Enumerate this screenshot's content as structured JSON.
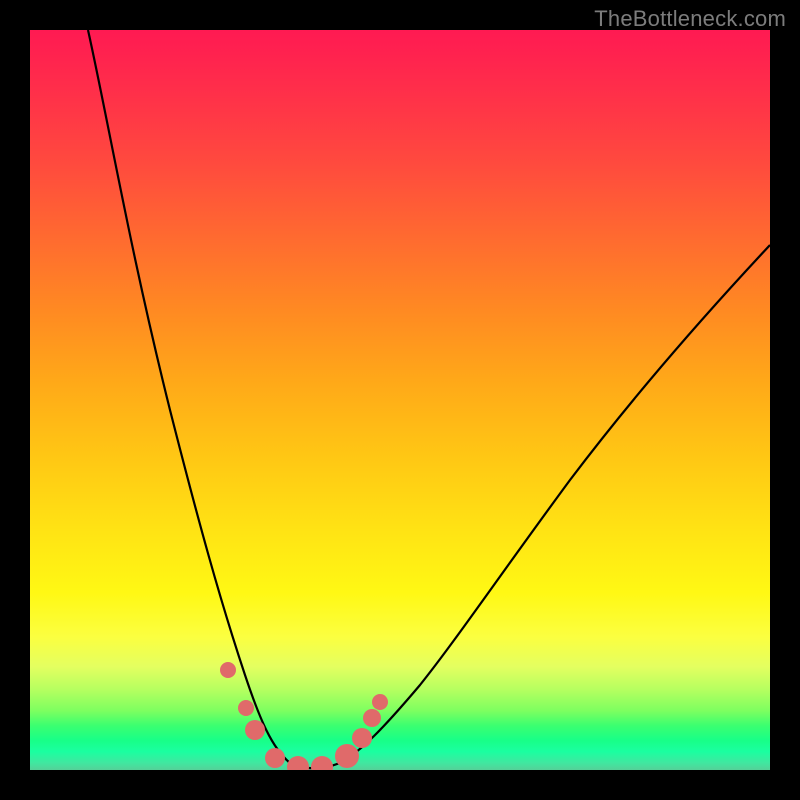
{
  "watermark": "TheBottleneck.com",
  "chart_data": {
    "type": "line",
    "title": "",
    "xlabel": "",
    "ylabel": "",
    "x_range_plot_units": [
      0,
      740
    ],
    "y_range_plot_units": [
      0,
      740
    ],
    "grid": false,
    "note": "Axes have no visible tick labels / units in the image; coordinates below are in plot-area pixel space (origin top-left of the 740x740 colored square). Curve is a smooth V-notch (bottleneck curve) touching the bottom around x≈250–310.",
    "series": [
      {
        "name": "bottleneck-curve",
        "x": [
          58,
          80,
          110,
          140,
          170,
          195,
          215,
          232,
          248,
          260,
          275,
          295,
          310,
          330,
          355,
          390,
          430,
          480,
          540,
          610,
          690,
          740
        ],
        "y": [
          0,
          110,
          250,
          380,
          490,
          580,
          645,
          690,
          720,
          733,
          738,
          738,
          733,
          720,
          698,
          655,
          600,
          530,
          450,
          360,
          270,
          215
        ]
      }
    ],
    "markers": {
      "name": "highlight-dots",
      "color_hex": "#e06a6a",
      "points": [
        {
          "x": 198,
          "y": 640,
          "r": 8
        },
        {
          "x": 216,
          "y": 678,
          "r": 8
        },
        {
          "x": 225,
          "y": 700,
          "r": 10
        },
        {
          "x": 245,
          "y": 728,
          "r": 10
        },
        {
          "x": 268,
          "y": 737,
          "r": 11
        },
        {
          "x": 292,
          "y": 737,
          "r": 11
        },
        {
          "x": 317,
          "y": 726,
          "r": 12
        },
        {
          "x": 332,
          "y": 708,
          "r": 10
        },
        {
          "x": 342,
          "y": 688,
          "r": 9
        },
        {
          "x": 350,
          "y": 672,
          "r": 8
        }
      ]
    },
    "background_gradient": {
      "direction": "top-to-bottom",
      "stops": [
        {
          "pos": 0.0,
          "hex": "#ff1a52"
        },
        {
          "pos": 0.38,
          "hex": "#ff8a22"
        },
        {
          "pos": 0.68,
          "hex": "#ffe414"
        },
        {
          "pos": 0.92,
          "hex": "#7dff60"
        },
        {
          "pos": 1.0,
          "hex": "#55d098"
        }
      ]
    }
  }
}
